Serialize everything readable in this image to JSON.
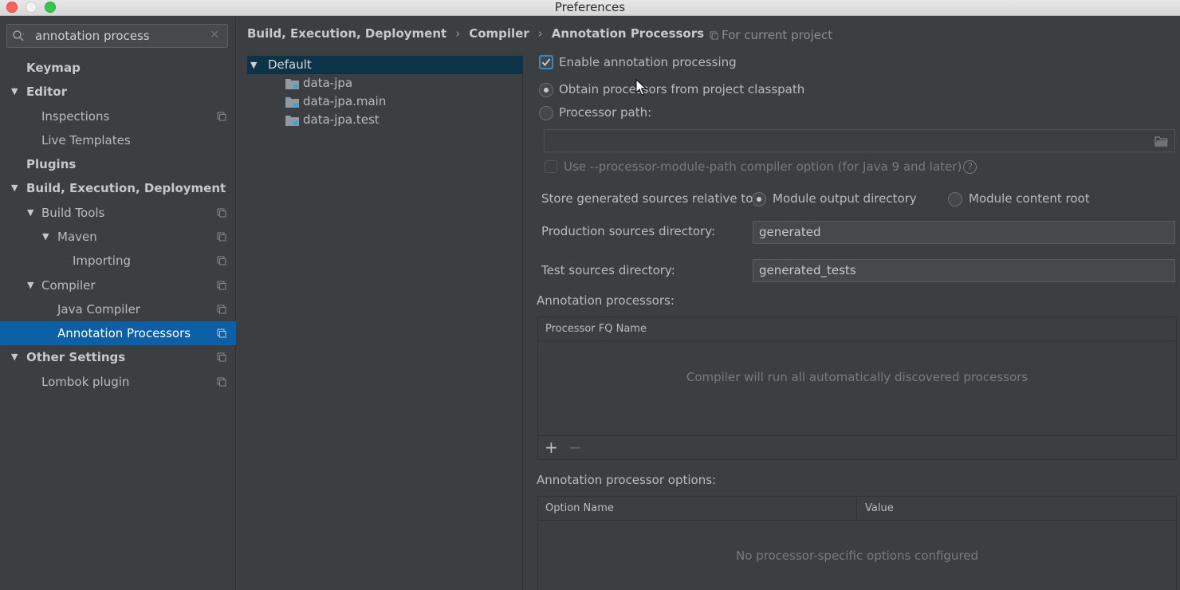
{
  "window": {
    "title": "Preferences"
  },
  "search": {
    "value": "annotation process"
  },
  "sidebar": {
    "items": [
      {
        "label": "Keymap"
      },
      {
        "label": "Editor"
      },
      {
        "label": "Inspections"
      },
      {
        "label": "Live Templates"
      },
      {
        "label": "Plugins"
      },
      {
        "label": "Build, Execution, Deployment"
      },
      {
        "label": "Build Tools"
      },
      {
        "label": "Maven"
      },
      {
        "label": "Importing"
      },
      {
        "label": "Compiler"
      },
      {
        "label": "Java Compiler"
      },
      {
        "label": "Annotation Processors"
      },
      {
        "label": "Other Settings"
      },
      {
        "label": "Lombok plugin"
      }
    ]
  },
  "breadcrumb": {
    "parts": [
      "Build, Execution, Deployment",
      "Compiler",
      "Annotation Processors"
    ],
    "separator": "›",
    "for_project": "For current project"
  },
  "modules": {
    "root": "Default",
    "children": [
      "data-jpa",
      "data-jpa.main",
      "data-jpa.test"
    ]
  },
  "settings": {
    "enable_label": "Enable annotation processing",
    "obtain_label": "Obtain processors from project classpath",
    "processor_path_label": "Processor path:",
    "processor_path_value": "",
    "module_path_option": "Use --processor-module-path compiler option (for Java 9 and later)",
    "help": "?",
    "store_label": "Store generated sources relative to:",
    "store_options": [
      "Module output directory",
      "Module content root"
    ],
    "production_label": "Production sources directory:",
    "production_value": "generated",
    "test_label": "Test sources directory:",
    "test_value": "generated_tests"
  },
  "processors_table": {
    "title": "Annotation processors:",
    "column": "Processor FQ Name",
    "empty": "Compiler will run all automatically discovered processors",
    "add": "+",
    "remove": "−"
  },
  "options_table": {
    "title": "Annotation processor options:",
    "columns": [
      "Option Name",
      "Value"
    ],
    "empty": "No processor-specific options configured"
  },
  "colors": {
    "selection": "#0d5fa6",
    "checkbox_accent": "#3d84c6",
    "background": "#3c3f41"
  }
}
